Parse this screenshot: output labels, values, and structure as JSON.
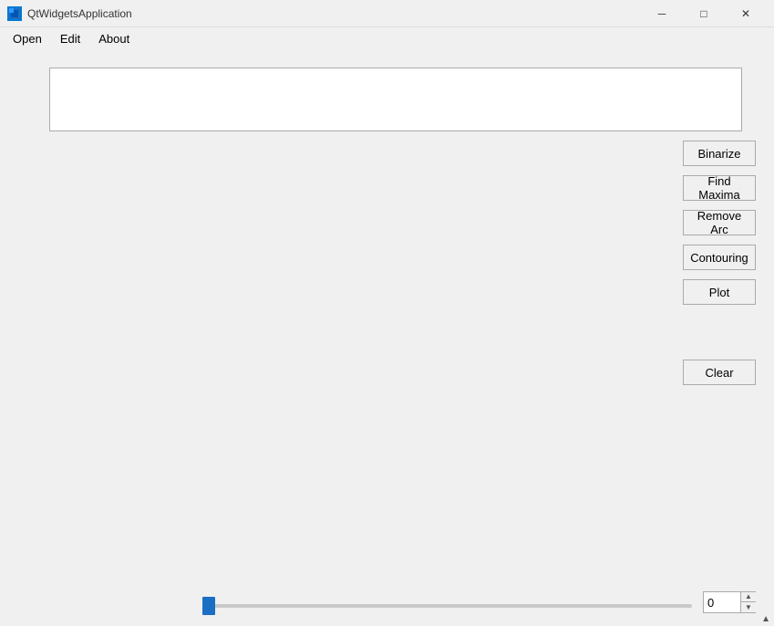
{
  "titleBar": {
    "title": "QtWidgetsApplication",
    "minimizeLabel": "─",
    "maximizeLabel": "□",
    "closeLabel": "✕"
  },
  "menuBar": {
    "items": [
      {
        "id": "open",
        "label": "Open"
      },
      {
        "id": "edit",
        "label": "Edit"
      },
      {
        "id": "about",
        "label": "About"
      }
    ]
  },
  "buttons": {
    "binarize": "Binarize",
    "findMaxima": "Find Maxima",
    "removeArc": "Remove Arc",
    "contouring": "Contouring",
    "plot": "Plot",
    "clear": "Clear"
  },
  "slider": {
    "min": 0,
    "max": 100,
    "value": 0
  },
  "spinbox": {
    "value": "0"
  },
  "icons": {
    "appIcon": "Q",
    "spinUp": "▲",
    "spinDown": "▼"
  }
}
